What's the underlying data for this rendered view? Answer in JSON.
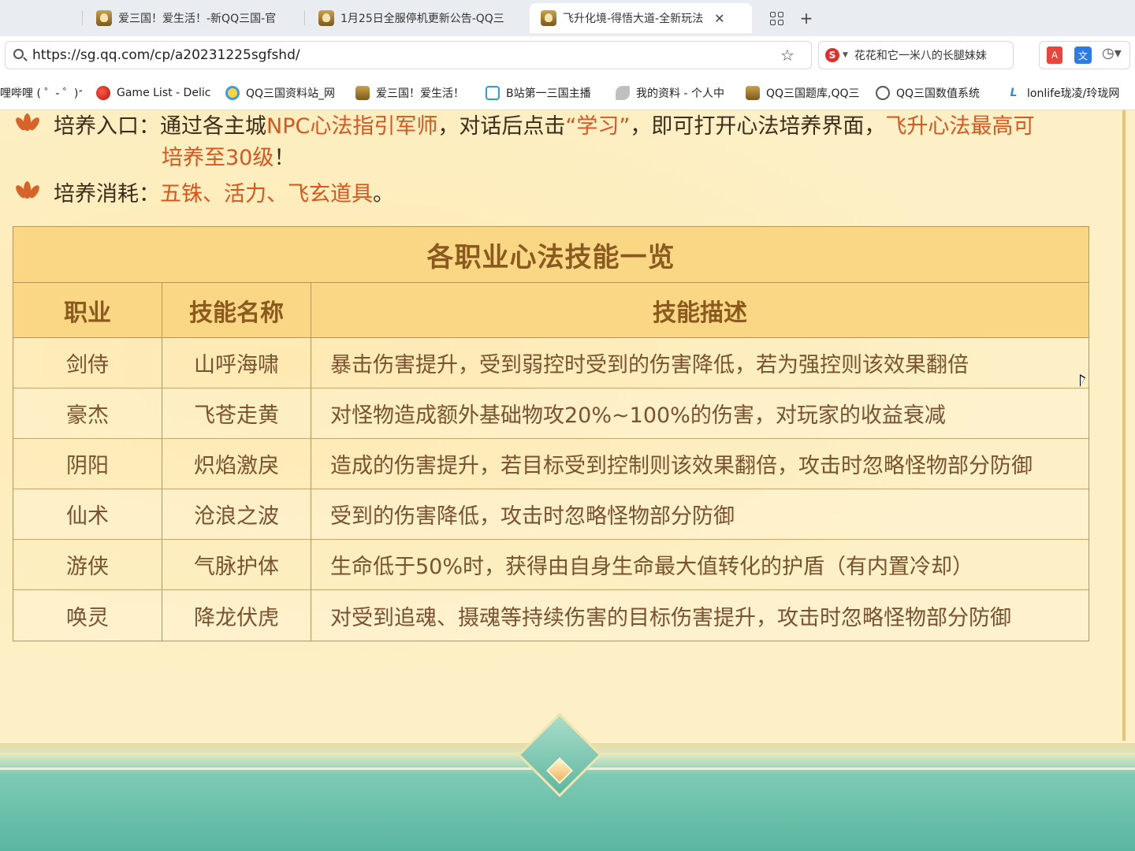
{
  "browser": {
    "tabs": [
      {
        "title": "爱三国！爱生活！-新QQ三国-官",
        "active": false
      },
      {
        "title": "1月25日全服停机更新公告-QQ三",
        "active": false
      },
      {
        "title": "飞升化境-得悟大道-全新玩法",
        "active": true
      }
    ],
    "tab_close": "✕",
    "new_tab": "+",
    "url": "https://sg.qq.com/cp/a20231225sgfshd/",
    "search_engine_letter": "S",
    "search_text": "花花和它一米八的长腿妹妹",
    "ext_pdf_label": "A",
    "ext_translate_label": "文",
    "bookmarks": [
      {
        "label": "哩哔哩 ( ゜- ゜)つ",
        "icon": "none"
      },
      {
        "label": "Game List - Delicious",
        "icon": "apple-icon"
      },
      {
        "label": "QQ三国资料站_网",
        "icon": "circle-icon"
      },
      {
        "label": "爱三国！爱生活！",
        "icon": "game-icon"
      },
      {
        "label": "B站第一三国主播",
        "icon": "tv-icon"
      },
      {
        "label": "我的资料 - 个人中",
        "icon": "bird-icon"
      },
      {
        "label": "QQ三国题库,QQ三",
        "icon": "game-icon"
      },
      {
        "label": "QQ三国数值系统",
        "icon": "globe-icon"
      },
      {
        "label": "lonlife珑凌/玲珑网",
        "icon": "lf-icon"
      }
    ]
  },
  "content": {
    "para1": {
      "prefix": "培养入口：通过各主城",
      "hl1": "NPC心法指引军师",
      "mid": "，对话后点击",
      "hl2": "“学习”",
      "mid2": "，即可打开心法培养界面，",
      "hl3": "飞升心法最高可",
      "line2_hl": "培养至30级",
      "line2_tail": "！"
    },
    "para2": {
      "prefix": "培养消耗：",
      "hl": "五铢、活力、飞玄道具",
      "tail": "。"
    },
    "table": {
      "title": "各职业心法技能一览",
      "headers": [
        "职业",
        "技能名称",
        "技能描述"
      ],
      "rows": [
        [
          "剑侍",
          "山呼海啸",
          "暴击伤害提升，受到弱控时受到的伤害降低，若为强控则该效果翻倍"
        ],
        [
          "豪杰",
          "飞苍走黄",
          "对怪物造成额外基础物攻20%~100%的伤害，对玩家的收益衰减"
        ],
        [
          "阴阳",
          "炽焰激戾",
          "造成的伤害提升，若目标受到控制则该效果翻倍，攻击时忽略怪物部分防御"
        ],
        [
          "仙术",
          "沧浪之波",
          "受到的伤害降低，攻击时忽略怪物部分防御"
        ],
        [
          "游侠",
          "气脉护体",
          "生命低于50%时，获得由自身生命最大值转化的护盾（有内置冷却）"
        ],
        [
          "唤灵",
          "降龙伏虎",
          "对受到追魂、摄魂等持续伤害的目标伤害提升，攻击时忽略怪物部分防御"
        ]
      ]
    }
  },
  "colors": {
    "page_bg": "#fdf0c6",
    "table_header_bg": "#f9d785",
    "highlight": "#d9561f",
    "footer_teal": "#5ab69f"
  }
}
